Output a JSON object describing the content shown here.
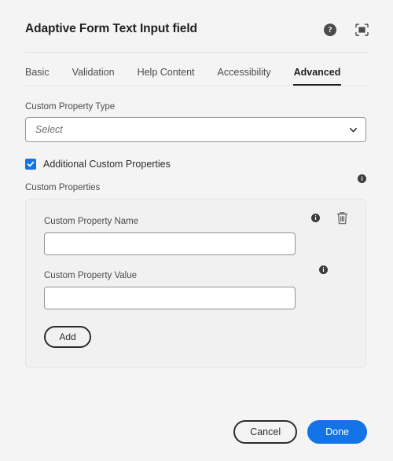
{
  "header": {
    "title": "Adaptive Form Text Input field",
    "help_icon": "help-circle-icon",
    "fullscreen_icon": "fullscreen-maximize-icon"
  },
  "tabs": [
    {
      "label": "Basic",
      "active": false
    },
    {
      "label": "Validation",
      "active": false
    },
    {
      "label": "Help Content",
      "active": false
    },
    {
      "label": "Accessibility",
      "active": false
    },
    {
      "label": "Advanced",
      "active": true
    }
  ],
  "main": {
    "custom_property_type": {
      "label": "Custom Property Type",
      "placeholder": "Select",
      "value": "",
      "chevron_icon": "chevron-down-icon"
    },
    "additional_custom_properties": {
      "label": "Additional Custom Properties",
      "checked": true
    },
    "custom_properties": {
      "label": "Custom Properties",
      "info_icon": "info-icon",
      "rows": [
        {
          "name_label": "Custom Property Name",
          "name_value": "",
          "name_info_icon": "info-icon",
          "delete_icon": "trash-delete-icon",
          "value_label": "Custom Property Value",
          "value_value": "",
          "value_info_icon": "info-icon"
        }
      ],
      "add_label": "Add"
    }
  },
  "footer": {
    "cancel_label": "Cancel",
    "done_label": "Done"
  },
  "colors": {
    "accent": "#1473E6",
    "page_bg": "#F4F4F4",
    "card_bg": "#F1F1F1",
    "text": "#2C2C2C",
    "muted_text": "#4B4B4B",
    "border": "#949494"
  },
  "glyphs": {
    "info": "i",
    "help": "?"
  }
}
